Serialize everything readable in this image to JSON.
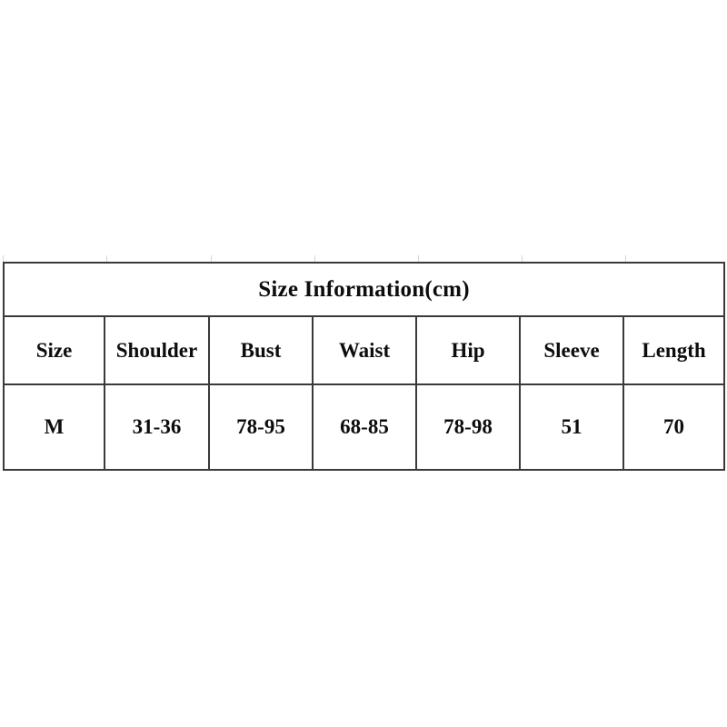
{
  "page": {
    "background_color": "#ffffff",
    "text_color": "#0d0d0d",
    "border_color": "#3a3a3a",
    "tick_color": "#d5d5d5"
  },
  "size_table": {
    "title": "Size Information(cm)",
    "columns": [
      "Size",
      "Shoulder",
      "Bust",
      "Waist",
      "Hip",
      "Sleeve",
      "Length"
    ],
    "rows": [
      {
        "size": "M",
        "shoulder": "31-36",
        "bust": "78-95",
        "waist": "68-85",
        "hip": "78-98",
        "sleeve": "51",
        "length": "70"
      }
    ]
  },
  "chart_data": {
    "type": "table",
    "title": "Size Information(cm)",
    "columns": [
      "Size",
      "Shoulder",
      "Bust",
      "Waist",
      "Hip",
      "Sleeve",
      "Length"
    ],
    "rows": [
      [
        "M",
        "31-36",
        "78-95",
        "68-85",
        "78-98",
        "51",
        "70"
      ]
    ],
    "units": "cm"
  }
}
